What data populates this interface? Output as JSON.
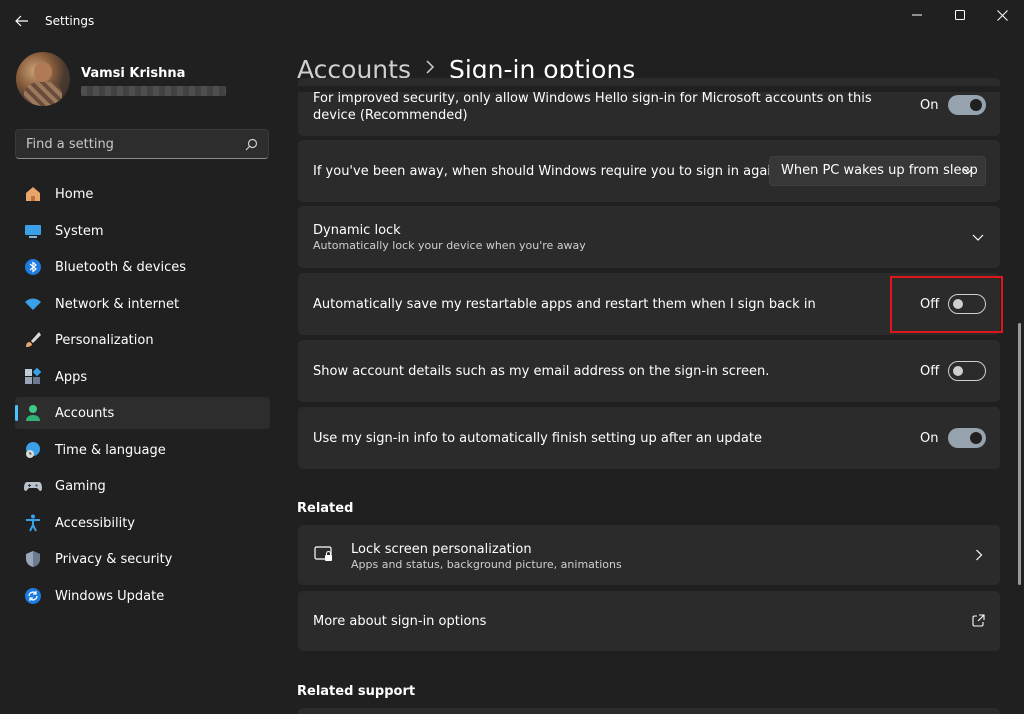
{
  "window": {
    "title": "Settings",
    "controls": [
      "minimize",
      "maximize",
      "close"
    ]
  },
  "profile": {
    "name": "Vamsi Krishna"
  },
  "search": {
    "placeholder": "Find a setting"
  },
  "sidebar": {
    "items": [
      {
        "label": "Home",
        "icon": "home-icon",
        "active": false
      },
      {
        "label": "System",
        "icon": "monitor-icon",
        "active": false
      },
      {
        "label": "Bluetooth & devices",
        "icon": "bluetooth-icon",
        "active": false
      },
      {
        "label": "Network & internet",
        "icon": "wifi-icon",
        "active": false
      },
      {
        "label": "Personalization",
        "icon": "brush-icon",
        "active": false
      },
      {
        "label": "Apps",
        "icon": "apps-icon",
        "active": false
      },
      {
        "label": "Accounts",
        "icon": "person-icon",
        "active": true
      },
      {
        "label": "Time & language",
        "icon": "globe-clock-icon",
        "active": false
      },
      {
        "label": "Gaming",
        "icon": "gamepad-icon",
        "active": false
      },
      {
        "label": "Accessibility",
        "icon": "accessibility-icon",
        "active": false
      },
      {
        "label": "Privacy & security",
        "icon": "shield-icon",
        "active": false
      },
      {
        "label": "Windows Update",
        "icon": "update-icon",
        "active": false
      }
    ]
  },
  "breadcrumb": {
    "parent": "Accounts",
    "current": "Sign-in options"
  },
  "settings": {
    "hello_only": {
      "text": "For improved security, only allow Windows Hello sign-in for Microsoft accounts on this device (Recommended)",
      "state": "On"
    },
    "require_signin": {
      "text": "If you've been away, when should Windows require you to sign in again?",
      "value": "When PC wakes up from sleep"
    },
    "dynamic_lock": {
      "title": "Dynamic lock",
      "subtitle": "Automatically lock your device when you're away"
    },
    "restart_apps": {
      "text": "Automatically save my restartable apps and restart them when I sign back in",
      "state": "Off"
    },
    "account_details": {
      "text": "Show account details such as my email address on the sign-in screen.",
      "state": "Off"
    },
    "signin_info": {
      "text": "Use my sign-in info to automatically finish setting up after an update",
      "state": "On"
    }
  },
  "related": {
    "heading": "Related",
    "lock_screen": {
      "title": "Lock screen personalization",
      "subtitle": "Apps and status, background picture, animations"
    },
    "more_signin": {
      "title": "More about sign-in options"
    }
  },
  "related_support": {
    "heading": "Related support"
  },
  "colors": {
    "accent": "#4cc2ff",
    "highlight": "#e0161d",
    "background": "#202020",
    "card": "#2b2b2b"
  }
}
